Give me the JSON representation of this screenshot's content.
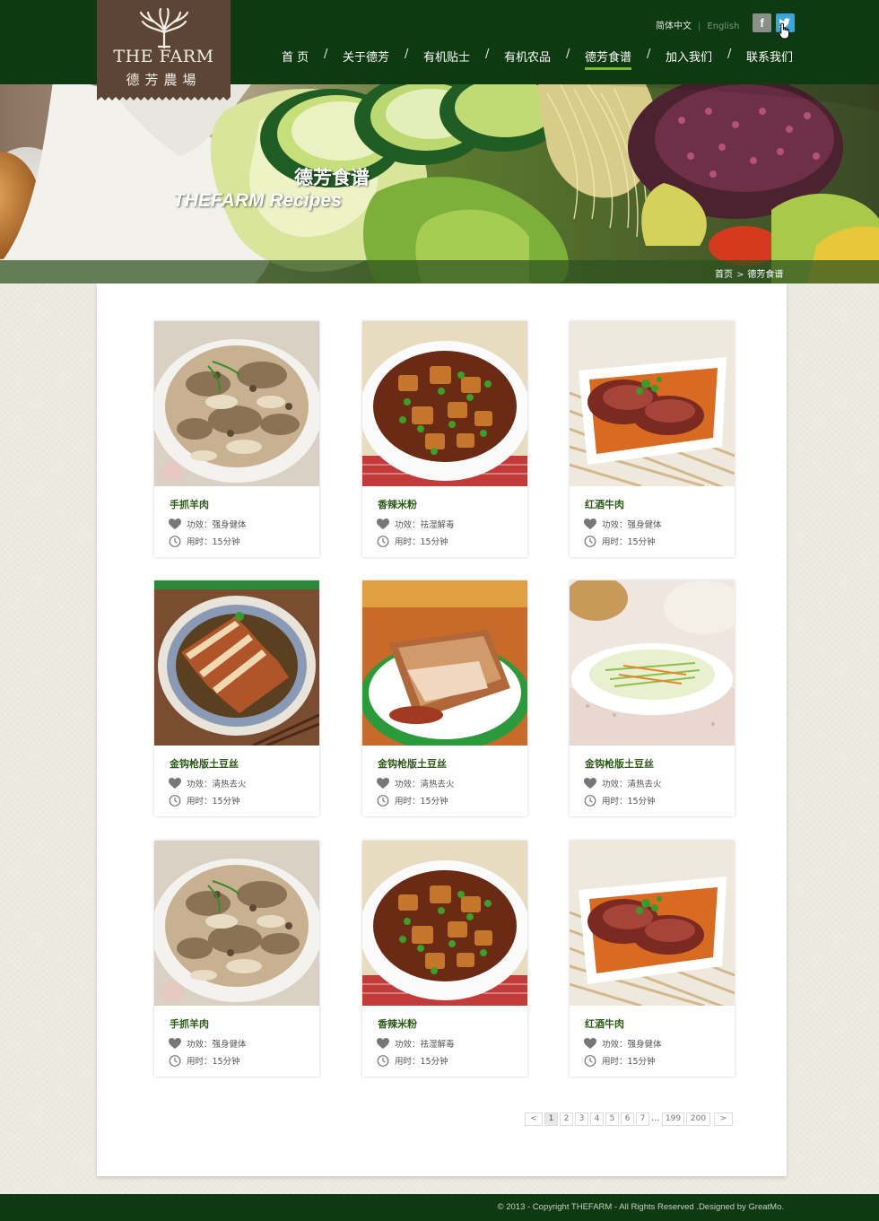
{
  "brand": {
    "logo_en": "THE  FARM",
    "logo_cn": "德芳農場"
  },
  "lang": {
    "cn": "简体中文",
    "sep": "|",
    "en": "English"
  },
  "social": {
    "facebook": "f",
    "twitter": "t"
  },
  "nav": [
    {
      "label": "首 页"
    },
    {
      "label": "关于德芳"
    },
    {
      "label": "有机贴士"
    },
    {
      "label": "有机农品"
    },
    {
      "label": "德芳食谱"
    },
    {
      "label": "加入我们"
    },
    {
      "label": "联系我们"
    }
  ],
  "nav_separator": "/",
  "nav_active_index": 4,
  "banner": {
    "title_cn": "德芳食谱",
    "title_en": "THEFARM Recipes"
  },
  "breadcrumb": {
    "home": "首页",
    "sep": ">",
    "current": "德芳食谱"
  },
  "recipes": [
    {
      "title": "手抓羊肉",
      "effect": "功效：强身健体",
      "time": "用时：15分钟",
      "image": "lamb"
    },
    {
      "title": "香辣米粉",
      "effect": "功效：祛湿解毒",
      "time": "用时：15分钟",
      "image": "tofu"
    },
    {
      "title": "红酒牛肉",
      "effect": "功效：强身健体",
      "time": "用时：15分钟",
      "image": "beef"
    },
    {
      "title": "金钩枪版土豆丝",
      "effect": "功效：清热去火",
      "time": "用时：15分钟",
      "image": "pork"
    },
    {
      "title": "金钩枪版土豆丝",
      "effect": "功效：清热去火",
      "time": "用时：15分钟",
      "image": "ribs"
    },
    {
      "title": "金钩枪版土豆丝",
      "effect": "功效：清热去火",
      "time": "用时：15分钟",
      "image": "potato"
    },
    {
      "title": "手抓羊肉",
      "effect": "功效：强身健体",
      "time": "用时：15分钟",
      "image": "lamb"
    },
    {
      "title": "香辣米粉",
      "effect": "功效：祛湿解毒",
      "time": "用时：15分钟",
      "image": "tofu"
    },
    {
      "title": "红酒牛肉",
      "effect": "功效：强身健体",
      "time": "用时：15分钟",
      "image": "beef"
    }
  ],
  "pagination": {
    "prev": "<",
    "pages": [
      "1",
      "2",
      "3",
      "4",
      "5",
      "6",
      "7"
    ],
    "ellipsis": "...",
    "last_pages": [
      "199",
      "200"
    ],
    "next": ">",
    "current": "1"
  },
  "footer": {
    "copyright": "© 2013 - Copyright THEFARM - All Rights Reserved .Designed by GreatMo."
  },
  "colors": {
    "header_bg": "#0d3a10",
    "logo_bg": "#5c4535",
    "accent": "#7ab82c",
    "title_green": "#2d5a18"
  }
}
